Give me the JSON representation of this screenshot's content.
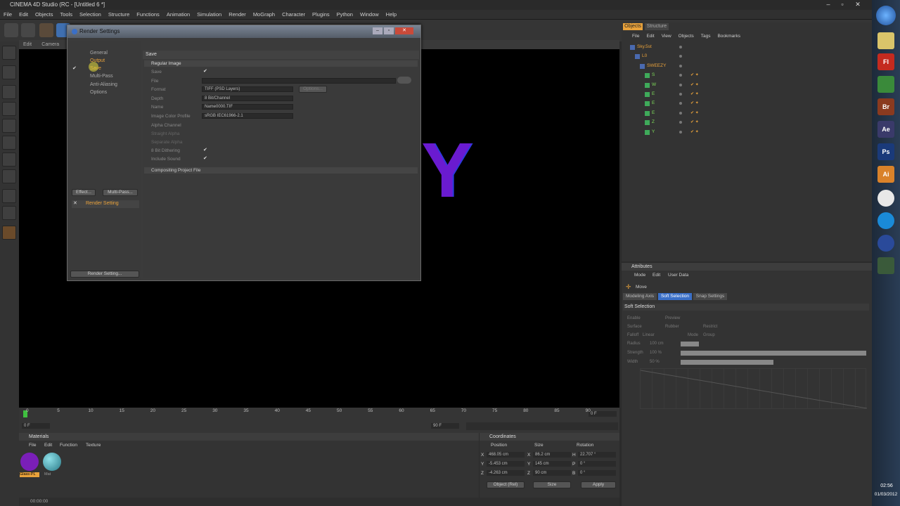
{
  "window": {
    "title": "CINEMA 4D Studio (RC - [Untitled 6 *]"
  },
  "menu": [
    "File",
    "Edit",
    "Objects",
    "Tools",
    "Selection",
    "Structure",
    "Functions",
    "Animation",
    "Simulation",
    "Render",
    "MoGraph",
    "Character",
    "Plugins",
    "Python",
    "Window",
    "Help"
  ],
  "viewport": {
    "menu": [
      "Edit",
      "Camera"
    ]
  },
  "render_dialog": {
    "title": "Render Settings",
    "nav": [
      "General",
      "Output",
      "Save",
      "Multi-Pass",
      "Anti-Aliasing",
      "Options"
    ],
    "effect_btn": "Effect...",
    "multipass_btn": "Multi-Pass...",
    "setting_name": "Render Setting",
    "bottom_btn": "Render Setting...",
    "section": "Save",
    "group": "Regular Image",
    "labels": {
      "save": "Save",
      "file": "File",
      "format": "Format",
      "depth": "Depth",
      "name": "Name",
      "profile": "Image Color Profile",
      "alpha": "Alpha Channel",
      "straight": "Straight Alpha",
      "separate": "Separate Alpha",
      "dither": "8 Bit Dithering",
      "sound": "Include Sound"
    },
    "values": {
      "format": "TIFF (PSD Layers)",
      "depth": "8 Bit/Channel",
      "name": "Name0000.TIF",
      "profile": "sRGB IEC61966-2.1",
      "options": "Options...",
      "check": "✔"
    },
    "compositing": "Compositing Project File"
  },
  "timeline": {
    "ticks": [
      "0",
      "5",
      "10",
      "15",
      "20",
      "25",
      "30",
      "35",
      "40",
      "45",
      "50",
      "55",
      "60",
      "65",
      "70",
      "75",
      "80",
      "85",
      "90"
    ],
    "current": "0 F",
    "start": "0 F",
    "end": "90 F",
    "frame_right": "0 F"
  },
  "materials": {
    "header": "Materials",
    "menu": [
      "File",
      "Edit",
      "Function",
      "Texture"
    ],
    "items": [
      "Glass-PL",
      "Mat"
    ]
  },
  "coordinates": {
    "header": "Coordinates",
    "cols": [
      "Position",
      "Size",
      "Rotation"
    ],
    "rows": [
      {
        "axis": "X",
        "pos": "468.05 cm",
        "sa": "X",
        "size": "86.2 cm",
        "ra": "H",
        "rot": "22.707 °"
      },
      {
        "axis": "Y",
        "pos": "-5.453 cm",
        "sa": "Y",
        "size": "145 cm",
        "ra": "P",
        "rot": "0 °"
      },
      {
        "axis": "Z",
        "pos": "-4.263 cm",
        "sa": "Z",
        "size": "90 cm",
        "ra": "B",
        "rot": "0 °"
      }
    ],
    "mode": "Object (Rel)",
    "size_mode": "Size",
    "apply": "Apply"
  },
  "objects": {
    "tabs": [
      "Objects",
      "Structure"
    ],
    "menu": [
      "File",
      "Edit",
      "View",
      "Objects",
      "Tags",
      "Bookmarks"
    ],
    "items": [
      {
        "name": "Sky.5st",
        "indent": 0
      },
      {
        "name": "L0",
        "indent": 1
      },
      {
        "name": "SWEEZY",
        "indent": 2
      },
      {
        "name": "S",
        "indent": 3
      },
      {
        "name": "W",
        "indent": 3
      },
      {
        "name": "E",
        "indent": 3
      },
      {
        "name": "E",
        "indent": 3
      },
      {
        "name": "E",
        "indent": 3
      },
      {
        "name": "Z",
        "indent": 3
      },
      {
        "name": "Y",
        "indent": 3
      }
    ]
  },
  "attributes": {
    "header": "Attributes",
    "menu": [
      "Mode",
      "Edit",
      "User Data"
    ],
    "tool": "Move",
    "tabs": [
      "Modeling Axis",
      "Soft Selection",
      "Snap Settings"
    ],
    "section": "Soft Selection",
    "fields": [
      "Enable",
      "Preview",
      "Surface",
      "Rubber",
      "Restrict",
      "Falloff",
      "Linear",
      "Mode",
      "Group",
      "Radius",
      "100 cm",
      "Strength",
      "100 %",
      "Width",
      "50 %"
    ]
  },
  "status": {
    "time": "00:00:00"
  },
  "taskbar": {
    "clock": "02:56",
    "date": "01/03/2012",
    "apps": [
      "Fl",
      "Br",
      "Ae",
      "Ps",
      "Ai"
    ]
  },
  "viewport_text": "Y",
  "colors": {
    "selected": "#e9a23b",
    "dialog_title": "#5d6673"
  }
}
